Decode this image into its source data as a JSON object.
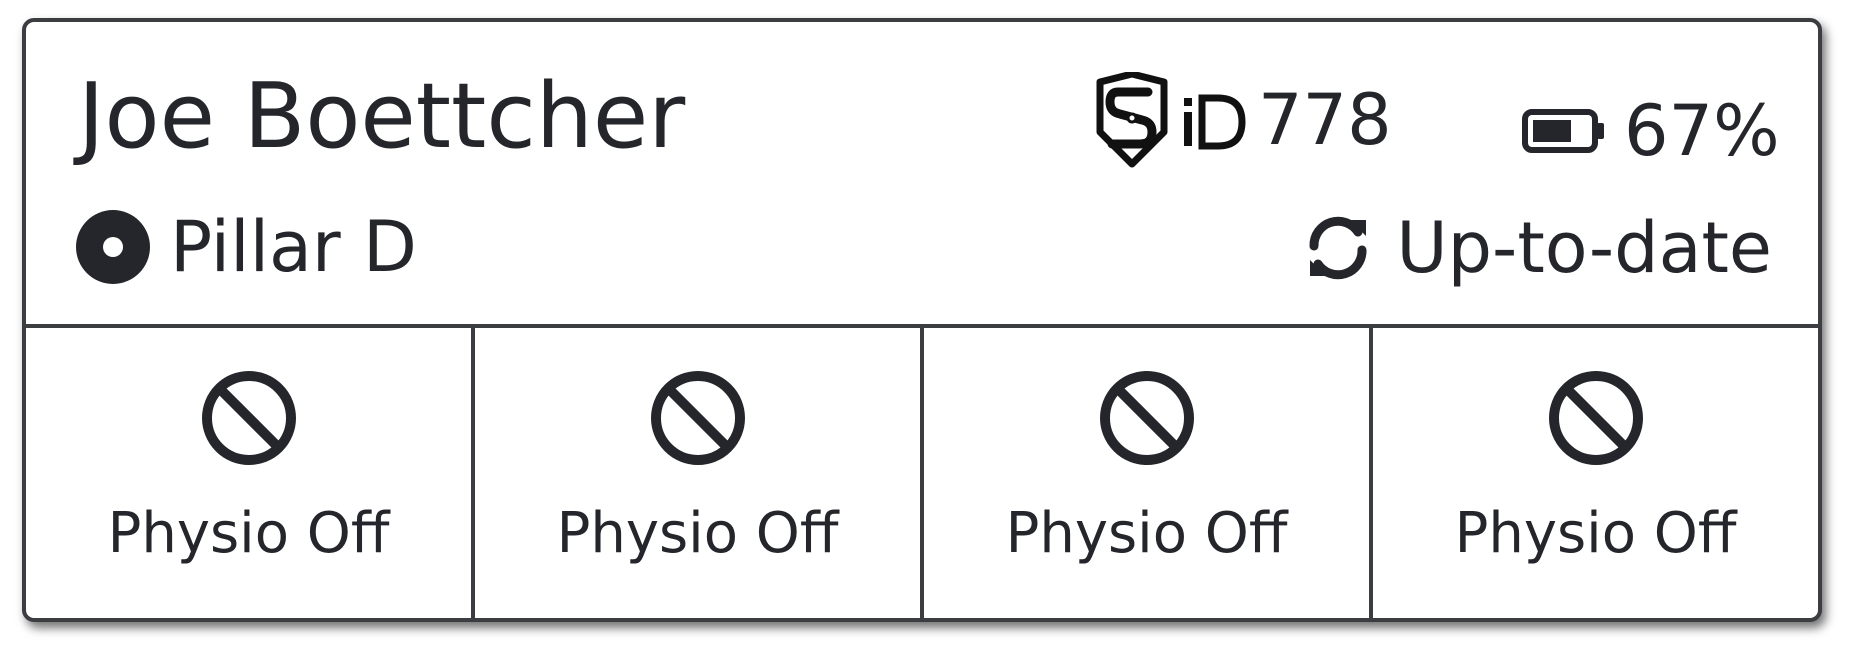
{
  "header": {
    "name": "Joe Boettcher",
    "location": "Pillar D",
    "sid_value": "778",
    "battery_value": "67%",
    "sync_status": "Up-to-date",
    "icons": {
      "location": "target-dot-icon",
      "sid": "sid-shield-icon",
      "battery": "battery-icon",
      "sync": "sync-icon"
    }
  },
  "channels": [
    {
      "label": "Physio Off",
      "icon": "prohibited-icon"
    },
    {
      "label": "Physio Off",
      "icon": "prohibited-icon"
    },
    {
      "label": "Physio Off",
      "icon": "prohibited-icon"
    },
    {
      "label": "Physio Off",
      "icon": "prohibited-icon"
    }
  ],
  "battery_level": 0.67,
  "colors": {
    "text": "#24262b",
    "border": "#3b3d40",
    "background": "#ffffff"
  }
}
